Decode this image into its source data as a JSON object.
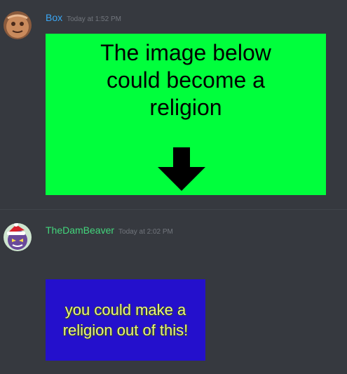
{
  "messages": [
    {
      "username": "Box",
      "username_color": "#3ba7f5",
      "timestamp": "Today at 1:52 PM",
      "avatar": "orange-rag-doll-avatar",
      "attachment": {
        "background": "#00ff3c",
        "caption_lines": [
          "The image below",
          "could become a",
          "religion"
        ],
        "icon": "down-arrow-icon"
      }
    },
    {
      "username": "TheDamBeaver",
      "username_color": "#43d67c",
      "timestamp": "Today at 2:02 PM",
      "avatar": "purple-pokemon-santa-hat-avatar",
      "attachment": {
        "background": "#2410cc",
        "caption_lines": [
          "you could make a",
          "religion out of this!"
        ]
      }
    }
  ]
}
